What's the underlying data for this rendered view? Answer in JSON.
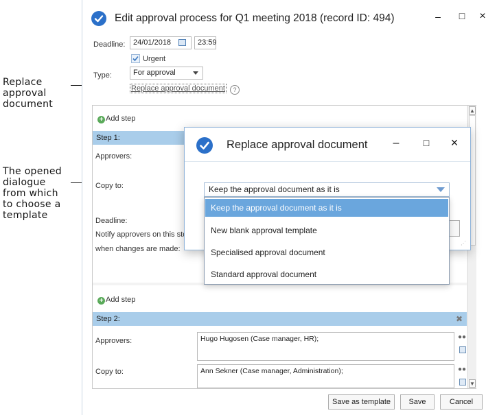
{
  "callouts": {
    "replace": [
      "Replace",
      "approval",
      "document"
    ],
    "dialogue": [
      "The opened",
      "dialogue",
      "from which",
      "to choose a",
      "template"
    ]
  },
  "window": {
    "title": "Edit approval process for Q1 meeting 2018 (record ID: 494)",
    "minimize": "‒",
    "maximize": "□",
    "close": "×"
  },
  "form": {
    "deadline_label": "Deadline:",
    "deadline_date": "24/01/2018",
    "deadline_time": "23:59",
    "urgent_label": "Urgent",
    "urgent_checked": true,
    "type_label": "Type:",
    "type_value": "For approval",
    "replace_link": "Replace approval document",
    "help": "?"
  },
  "steps": {
    "add_step_label": "Add step",
    "step1": {
      "header": "Step 1:",
      "approvers_label": "Approvers:",
      "copy_to_label": "Copy to:",
      "deadline_label": "Deadline:",
      "notify_line1": "Notify approvers on this ste",
      "notify_line2": "when changes are made:"
    },
    "step2": {
      "header": "Step 2:",
      "remove_icon": "✖",
      "approvers_label": "Approvers:",
      "approvers_value": "Hugo Hugosen (Case manager, HR);",
      "copy_to_label": "Copy to:",
      "copy_to_value": "Ann Sekner (Case manager, Administration);"
    }
  },
  "buttons": {
    "save_template": "Save as template",
    "save": "Save",
    "cancel": "Cancel"
  },
  "dialog": {
    "title": "Replace approval document",
    "minimize": "‒",
    "maximize": "□",
    "close": "×",
    "selected": "Keep the approval document as it is",
    "options": [
      "Keep the approval document as it is",
      "New blank approval template",
      "Specialised approval document",
      "Standard approval document"
    ]
  },
  "colors": {
    "accent": "#2b70c9",
    "step_header": "#a9cdea",
    "dropdown_selected": "#6aa6dd"
  }
}
